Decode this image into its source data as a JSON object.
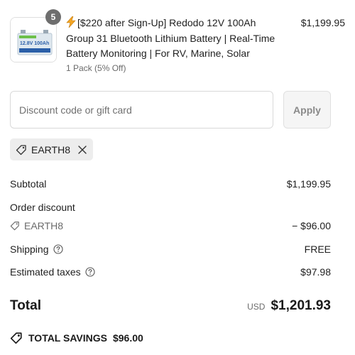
{
  "product": {
    "quantity_badge": "5",
    "title": "[$220 after Sign-Up] Redodo 12V 100Ah Group 31 Bluetooth Lithium Battery | Real-Time Battery Monitoring | For RV, Marine, Solar",
    "variant": "1 Pack (5% Off)",
    "price": "$1,199.95",
    "thumbnail_text": "12.8V 100Ah"
  },
  "discount": {
    "placeholder": "Discount code or gift card",
    "value": "",
    "apply_label": "Apply",
    "applied_code": "EARTH8"
  },
  "summary": {
    "subtotal_label": "Subtotal",
    "subtotal_value": "$1,199.95",
    "order_discount_label": "Order discount",
    "order_discount_code": "EARTH8",
    "order_discount_value": "− $96.00",
    "shipping_label": "Shipping",
    "shipping_value": "FREE",
    "taxes_label": "Estimated taxes",
    "taxes_value": "$97.98",
    "total_label": "Total",
    "total_currency": "USD",
    "total_value": "$1,201.93",
    "savings_label": "TOTAL SAVINGS",
    "savings_value": "$96.00"
  },
  "colors": {
    "bolt": "#f5a623",
    "chip_bg": "#ededed",
    "apply_bg": "#f5f5f5",
    "battery_body": "#dfe8ef",
    "battery_label": "#2b5fa8"
  },
  "icons": [
    "lightning-icon",
    "tag-icon",
    "close-icon",
    "help-circle-icon",
    "savings-tag-icon"
  ]
}
